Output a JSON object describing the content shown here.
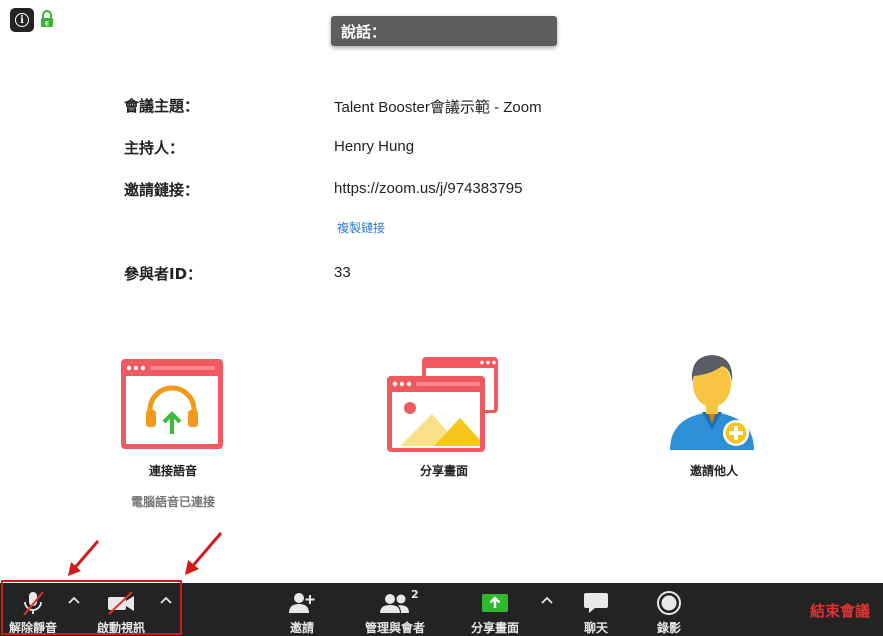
{
  "header": {
    "speaking_label": "說話："
  },
  "meeting_info": {
    "topic_label": "會議主題：",
    "topic_value": "Talent Booster會議示範 - Zoom",
    "host_label": "主持人：",
    "host_value": "Henry Hung",
    "invite_link_label": "邀請鏈接：",
    "invite_link_value": "https://zoom.us/j/974383795",
    "copy_link_label": "複製鏈接",
    "participant_id_label": "參與者ID：",
    "participant_id_value": "33"
  },
  "actions": {
    "join_audio_label": "連接語音",
    "join_audio_status": "電腦語音已連接",
    "share_screen_label": "分享畫面",
    "invite_others_label": "邀請他人"
  },
  "toolbar": {
    "unmute_label": "解除靜音",
    "start_video_label": "啟動視訊",
    "invite_label": "邀請",
    "manage_participants_label": "管理與會者",
    "participant_count": "2",
    "share_screen_label": "分享畫面",
    "chat_label": "聊天",
    "record_label": "錄影",
    "end_meeting_label": "結束會議"
  },
  "colors": {
    "toolbar_bg": "#232323",
    "tile_red": "#f05a5f",
    "end_meeting": "#e03131",
    "share_green": "#2dbb2d",
    "link_blue": "#2d7dd2",
    "annotation_red": "#d31a1a"
  }
}
